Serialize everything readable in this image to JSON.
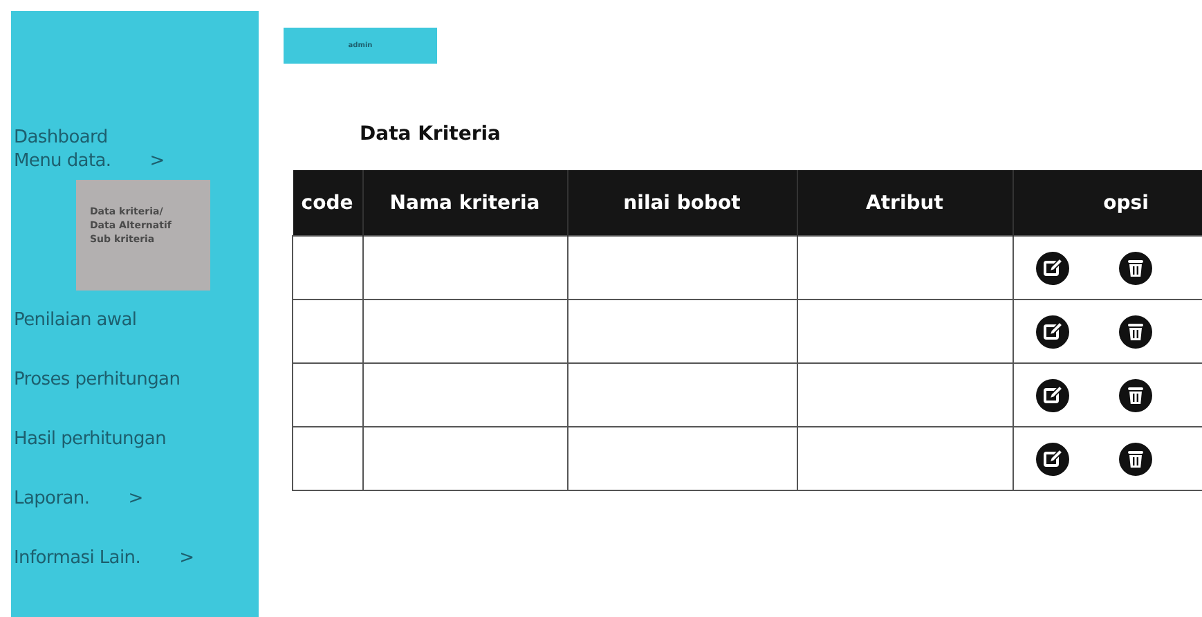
{
  "user_button": {
    "label": "admin"
  },
  "sidebar": {
    "items": [
      {
        "label": "Dashboard",
        "kind": "link"
      },
      {
        "label": "Menu data.",
        "arrow": ">",
        "kind": "menu",
        "children": [
          {
            "label": "Data kriteria/"
          },
          {
            "label": "Data Alternatif"
          },
          {
            "label": "Sub kriteria"
          }
        ]
      },
      {
        "label": "Penilaian awal",
        "kind": "link"
      },
      {
        "label": "Proses perhitungan",
        "kind": "link"
      },
      {
        "label": "Hasil perhitungan",
        "kind": "link"
      },
      {
        "label": "Laporan.",
        "arrow": ">",
        "kind": "menu"
      },
      {
        "label": "Informasi Lain.",
        "arrow": ">",
        "kind": "menu"
      }
    ]
  },
  "page_title": "Data Kriteria",
  "table": {
    "columns": [
      "code",
      "Nama kriteria",
      "nilai bobot",
      "Atribut",
      "opsi"
    ],
    "rows": [
      {
        "kind": "blank"
      },
      {
        "kind": "blank"
      },
      {
        "kind": "blank"
      },
      {
        "kind": "blank"
      }
    ]
  }
}
